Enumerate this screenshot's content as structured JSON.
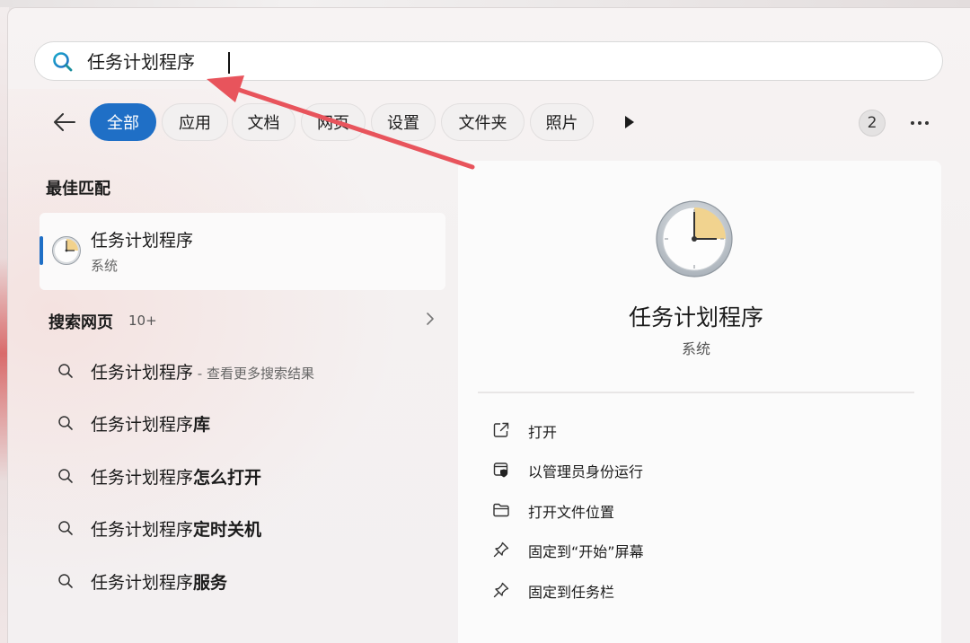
{
  "search": {
    "query": "任务计划程序",
    "icon": "search-icon"
  },
  "filters": {
    "tabs": [
      {
        "label": "全部",
        "active": true
      },
      {
        "label": "应用",
        "active": false
      },
      {
        "label": "文档",
        "active": false
      },
      {
        "label": "网页",
        "active": false
      },
      {
        "label": "设置",
        "active": false
      },
      {
        "label": "文件夹",
        "active": false
      },
      {
        "label": "照片",
        "active": false
      }
    ],
    "count_badge": "2"
  },
  "best_match": {
    "heading": "最佳匹配",
    "name": "任务计划程序",
    "subtitle": "系统",
    "icon": "clock-icon"
  },
  "web_search": {
    "heading": "搜索网页",
    "count": "10+",
    "suggestions": [
      {
        "base": "任务计划程序",
        "bold": "",
        "note": " - 查看更多搜索结果"
      },
      {
        "base": "任务计划程序",
        "bold": "库",
        "note": ""
      },
      {
        "base": "任务计划程序",
        "bold": "怎么打开",
        "note": ""
      },
      {
        "base": "任务计划程序",
        "bold": "定时关机",
        "note": ""
      },
      {
        "base": "任务计划程序",
        "bold": "服务",
        "note": ""
      }
    ]
  },
  "detail": {
    "name": "任务计划程序",
    "type": "系统",
    "actions": [
      {
        "label": "打开",
        "icon": "open-external-icon"
      },
      {
        "label": "以管理员身份运行",
        "icon": "shield-icon"
      },
      {
        "label": "打开文件位置",
        "icon": "folder-icon"
      },
      {
        "label": "固定到“开始”屏幕",
        "icon": "pin-icon"
      },
      {
        "label": "固定到任务栏",
        "icon": "pin-icon"
      }
    ]
  },
  "colors": {
    "accent": "#1f6fc6",
    "annotation": "#e8545c"
  }
}
